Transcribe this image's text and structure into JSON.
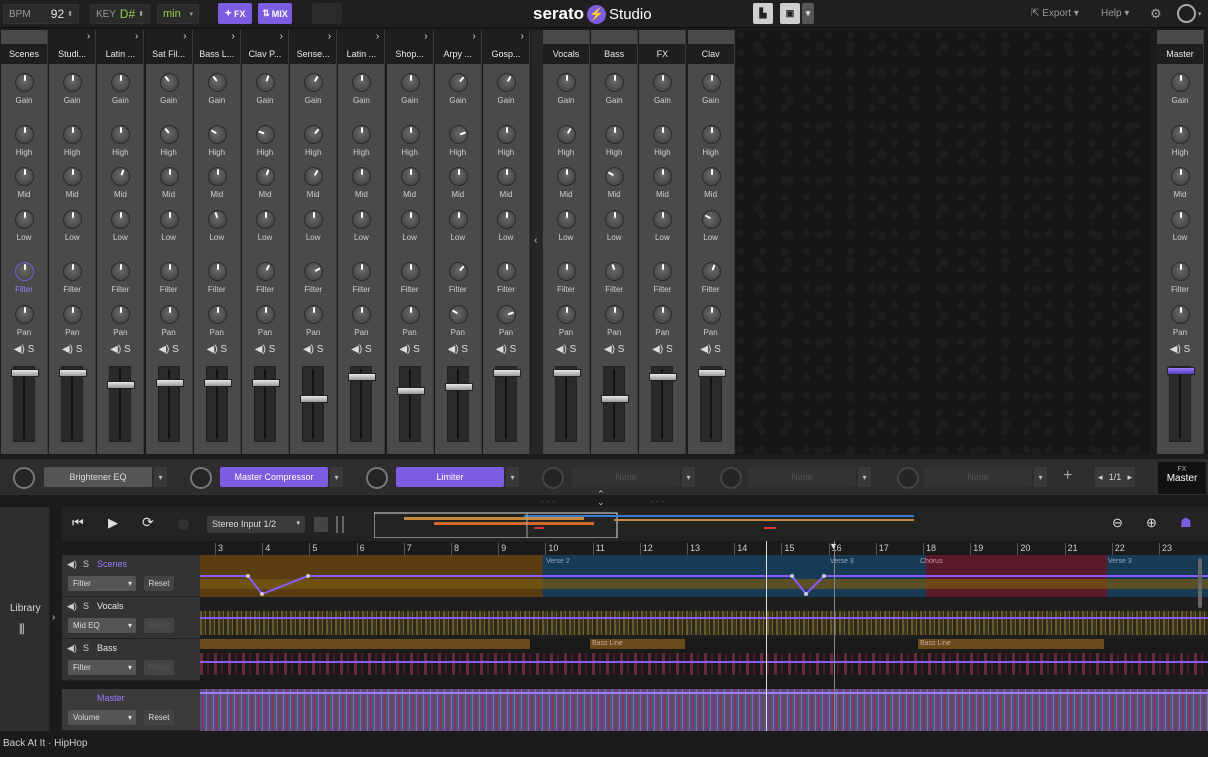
{
  "topbar": {
    "bpm_label": "BPM",
    "bpm_value": "92",
    "key_label": "KEY",
    "key_value": "D#",
    "key_mode": "min",
    "fx_button": "FX",
    "mix_button": "MIX",
    "logo_text": "serato",
    "logo_suffix": "Studio",
    "export_label": "Export",
    "help_label": "Help"
  },
  "mixer": {
    "knob_labels": [
      "Gain",
      "High",
      "Mid",
      "Low",
      "Filter",
      "Pan"
    ],
    "left_strips": [
      "Scenes",
      "Studi...",
      "Latin ...",
      "Sat Fil...",
      "Bass L...",
      "Clav P...",
      "Sense...",
      "Latin ...",
      "Shop...",
      "Arpy ...",
      "Gosp..."
    ],
    "right_strips": [
      "Vocals",
      "Bass",
      "FX",
      "Clav"
    ],
    "master_label": "Master",
    "solo_label": "S"
  },
  "fx_chain": {
    "slot1": "Brightener EQ",
    "slot2": "Master Compressor",
    "slot3": "Limiter",
    "slot4": "None",
    "slot5": "None",
    "slot6": "None",
    "page": "1/1",
    "fx_label": "FX",
    "master_label": "Master"
  },
  "arrangement": {
    "library_label": "Library",
    "input_select": "Stereo Input 1/2",
    "bar_numbers": [
      "3",
      "4",
      "5",
      "6",
      "7",
      "8",
      "9",
      "10",
      "11",
      "12",
      "13",
      "14",
      "15",
      "16",
      "17",
      "18",
      "19",
      "20",
      "21",
      "22",
      "23"
    ],
    "tracks": [
      {
        "name": "Scenes",
        "param": "Filter",
        "reset": "Reset"
      },
      {
        "name": "Vocals",
        "param": "Mid EQ",
        "reset": "Reset"
      },
      {
        "name": "Bass",
        "param": "Filter",
        "reset": "Reset"
      },
      {
        "name": "Master",
        "param": "Volume",
        "reset": "Reset"
      }
    ],
    "section_labels": [
      "Verse 2",
      "Verse 3",
      "Chorus",
      "Verse 3",
      "Bass Line",
      "Bass Line"
    ]
  },
  "status": {
    "project": "Back At It · HipHop"
  },
  "colors": {
    "accent": "#7c5ce0",
    "strip": "#4a4a4a",
    "background": "#1b1b1b"
  }
}
